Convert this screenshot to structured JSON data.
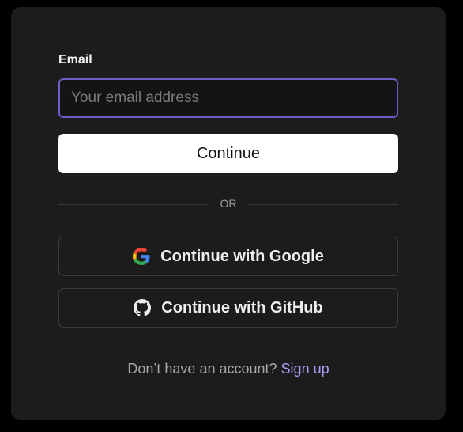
{
  "form": {
    "email_label": "Email",
    "email_value": "",
    "email_placeholder": "Your email address",
    "continue_label": "Continue",
    "divider_text": "OR",
    "google_label": "Continue with Google",
    "github_label": "Continue with GitHub",
    "no_account_text": "Don’t have an account?",
    "signup_link": "Sign up"
  },
  "icons": {
    "google": "google-logo-icon",
    "github": "github-logo-icon"
  },
  "colors": {
    "card_background": "#1c1c1c",
    "input_focus_border": "#6d5fc7",
    "primary_button": "#ffffff",
    "link": "#a99bf2"
  }
}
